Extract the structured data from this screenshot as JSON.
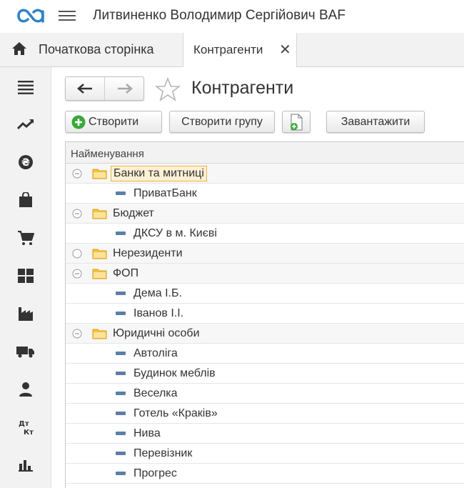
{
  "header": {
    "user_title": "Литвиненко Володимир Сергійович BAF"
  },
  "tabs": {
    "home_label": "Початкова сторінка",
    "active_label": "Контрагенти",
    "close_glyph": "✕"
  },
  "sidebar": {
    "items": [
      "menu",
      "trend",
      "finance",
      "sales-bag",
      "cart",
      "warehouse-grid",
      "factory",
      "truck",
      "person",
      "dt-kt",
      "bar-chart"
    ],
    "dtkt_top": "Дт",
    "dtkt_bottom": "Кт"
  },
  "page": {
    "title": "Контрагенти"
  },
  "toolbar": {
    "create_label": "Створити",
    "create_group_label": "Створити групу",
    "load_label": "Завантажити"
  },
  "list": {
    "column_header": "Найменування",
    "rows": [
      {
        "type": "group",
        "label": "Банки та митниці",
        "expanded": true,
        "selected": true
      },
      {
        "type": "item",
        "label": "ПриватБанк"
      },
      {
        "type": "group",
        "label": "Бюджет",
        "expanded": true
      },
      {
        "type": "item",
        "label": "ДКСУ в м. Києві"
      },
      {
        "type": "group",
        "label": "Нерезиденти",
        "expanded": false
      },
      {
        "type": "group",
        "label": "ФОП",
        "expanded": true
      },
      {
        "type": "item",
        "label": "Дема І.Б."
      },
      {
        "type": "item",
        "label": "Іванов І.І."
      },
      {
        "type": "group",
        "label": "Юридичні особи",
        "expanded": true
      },
      {
        "type": "item",
        "label": "Автоліга"
      },
      {
        "type": "item",
        "label": "Будинок меблів"
      },
      {
        "type": "item",
        "label": "Веселка"
      },
      {
        "type": "item",
        "label": "Готель «Краків»"
      },
      {
        "type": "item",
        "label": "Нива"
      },
      {
        "type": "item",
        "label": "Перевізник"
      },
      {
        "type": "item",
        "label": "Прогрес"
      }
    ]
  },
  "colors": {
    "folder": "#f5c342",
    "element_marker": "#5b7fa6",
    "create_green": "#3aa83a",
    "logo": "#2d82c7"
  }
}
